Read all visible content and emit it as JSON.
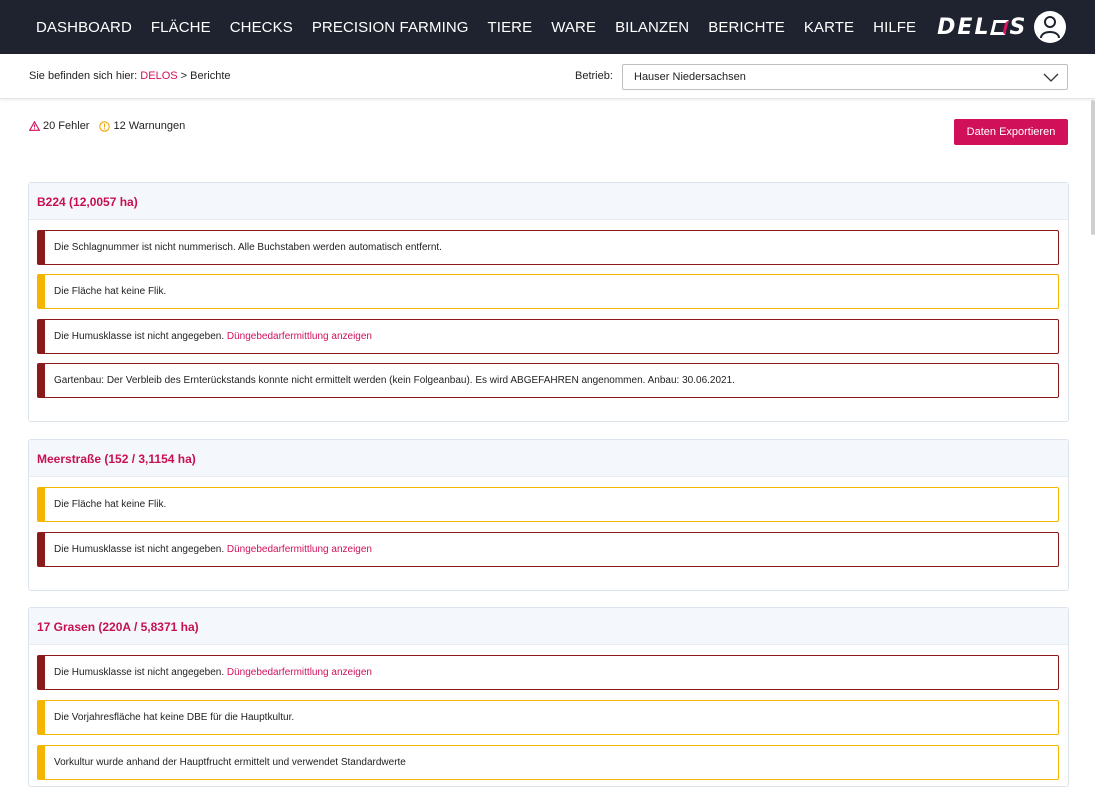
{
  "nav": {
    "items": [
      "DASHBOARD",
      "FLÄCHE",
      "CHECKS",
      "PRECISION FARMING",
      "TIERE",
      "WARE",
      "BILANZEN",
      "BERICHTE",
      "KARTE",
      "HILFE"
    ],
    "logo_prefix": "DEL",
    "logo_suffix": "S",
    "avatar_icon": "user-icon"
  },
  "breadcrumb": {
    "prefix": "Sie befinden sich hier: ",
    "home": "DELOS",
    "separator": " > ",
    "current": "Berichte"
  },
  "betrieb": {
    "label": "Betrieb:",
    "selected": "Hauser Niedersachsen"
  },
  "summary": {
    "errors": "20 Fehler",
    "warnings": "12 Warnungen"
  },
  "export_label": "Daten Exportieren",
  "colors": {
    "accent": "#d1105a",
    "error": "#8b1a1a",
    "warning": "#f5b400",
    "nav_bg": "#1f2330"
  },
  "cards": [
    {
      "title": "B224 (12,0057 ha)",
      "messages": [
        {
          "type": "error",
          "text": "Die Schlagnummer ist nicht nummerisch. Alle Buchstaben werden automatisch entfernt.",
          "link": ""
        },
        {
          "type": "warning",
          "text": "Die Fläche hat keine Flik.",
          "link": ""
        },
        {
          "type": "error",
          "text": "Die Humusklasse ist nicht angegeben. ",
          "link": "Düngebedarfermittlung anzeigen"
        },
        {
          "type": "error",
          "text": "Gartenbau: Der Verbleib des Ernterückstands konnte nicht ermittelt werden (kein Folgeanbau). Es wird ABGEFAHREN angenommen. Anbau: 30.06.2021.",
          "link": ""
        }
      ]
    },
    {
      "title": "Meerstraße (152 / 3,1154 ha)",
      "messages": [
        {
          "type": "warning",
          "text": "Die Fläche hat keine Flik.",
          "link": ""
        },
        {
          "type": "error",
          "text": "Die Humusklasse ist nicht angegeben. ",
          "link": "Düngebedarfermittlung anzeigen"
        }
      ]
    },
    {
      "title": "17 Grasen (220A / 5,8371 ha)",
      "messages": [
        {
          "type": "error",
          "text": "Die Humusklasse ist nicht angegeben. ",
          "link": "Düngebedarfermittlung anzeigen"
        },
        {
          "type": "warning",
          "text": "Die Vorjahresfläche hat keine DBE für die Hauptkultur.",
          "link": ""
        },
        {
          "type": "warning",
          "text": "Vorkultur wurde anhand der Hauptfrucht ermittelt und verwendet Standardwerte",
          "link": ""
        }
      ]
    }
  ]
}
